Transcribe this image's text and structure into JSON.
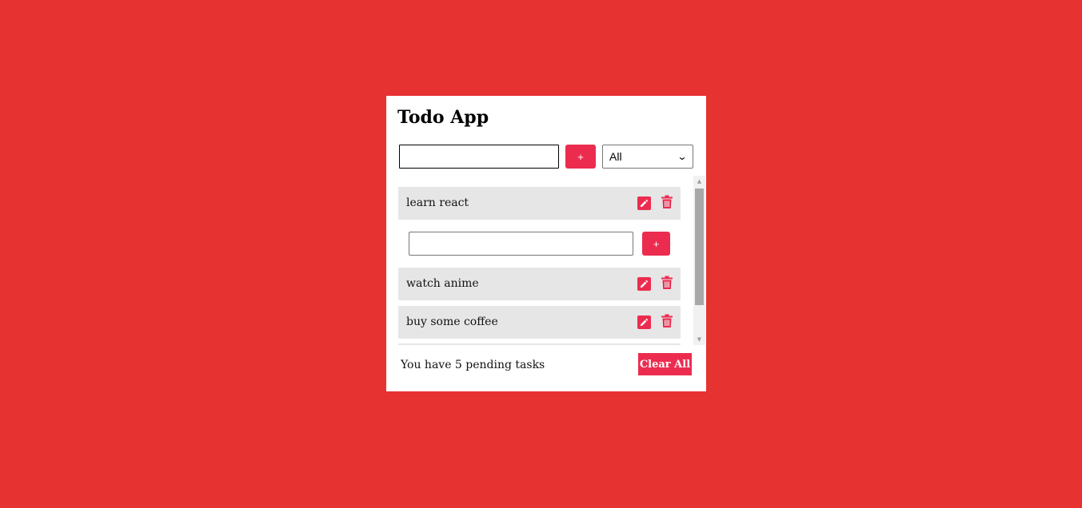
{
  "app": {
    "title": "Todo App"
  },
  "add_form": {
    "input_value": "",
    "input_placeholder": "",
    "add_label": "+",
    "filter_selected": "All"
  },
  "todos": [
    {
      "text": "learn react",
      "editing": true
    },
    {
      "text": "watch anime",
      "editing": false
    },
    {
      "text": "buy some coffee",
      "editing": false
    }
  ],
  "edit_form": {
    "input_value": "",
    "save_label": "+"
  },
  "footer": {
    "pending_text": "You have 5 pending tasks",
    "clear_label": "Clear All"
  },
  "icons": {
    "edit": "pencil-icon",
    "delete": "trash-icon",
    "filter_dropdown": "chevron-down-icon",
    "scroll_up": "scroll-up-arrow-icon",
    "scroll_down": "scroll-down-arrow-icon"
  },
  "colors": {
    "background": "#e73232",
    "accent": "#ec2c4f",
    "item_background": "#e6e6e6"
  }
}
